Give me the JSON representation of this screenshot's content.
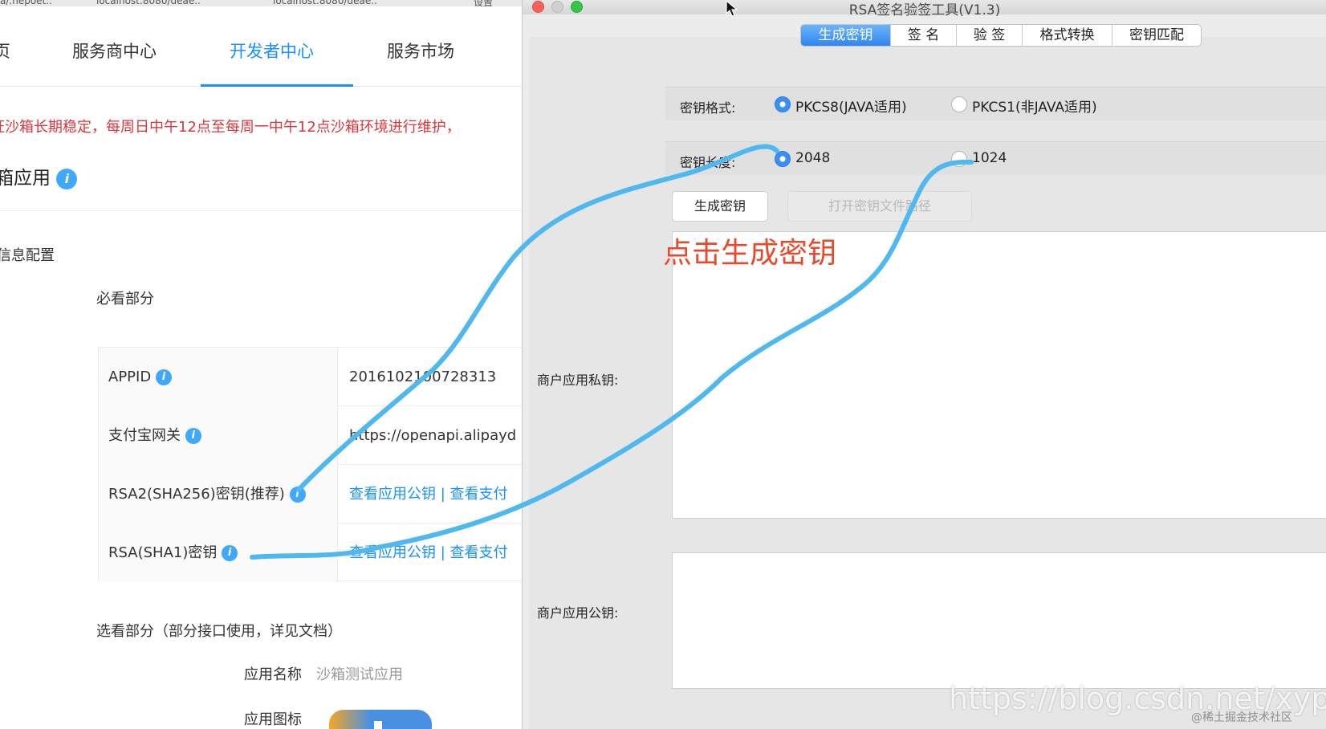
{
  "browser": {
    "tab_fragments": [
      "a/.hepoet..",
      "localhost:8080/deae..",
      "localhost:8080/deae..",
      "设置"
    ],
    "nav": {
      "items": [
        {
          "label": "页",
          "active": false
        },
        {
          "label": "服务商中心",
          "active": false
        },
        {
          "label": "开发者中心",
          "active": true
        },
        {
          "label": "服务市场",
          "active": false
        }
      ]
    },
    "notice": "证沙箱长期稳定，每周日中午12点至每周一中午12点沙箱环境进行维护，",
    "section_title": "箱应用",
    "sub_title": "信息配置",
    "must_title": "必看部分",
    "table": [
      {
        "label": "APPID",
        "value": "2016102100728313",
        "link": false
      },
      {
        "label": "支付宝网关",
        "value": "https://openapi.alipayd",
        "link": false
      },
      {
        "label": "RSA2(SHA256)密钥(推荐)",
        "value": "查看应用公钥 | 查看支付",
        "link": true
      },
      {
        "label": "RSA(SHA1)密钥",
        "value": "查看应用公钥 | 查看支付",
        "link": true
      }
    ],
    "optional_title": "选看部分（部分接口使用，详见文档）",
    "app_name_label": "应用名称",
    "app_name_value": "沙箱测试应用",
    "app_icon_label": "应用图标"
  },
  "tool": {
    "window_title": "RSA签名验签工具(V1.3)",
    "tabs": [
      {
        "label": "生成密钥",
        "active": true
      },
      {
        "label": "签 名",
        "active": false
      },
      {
        "label": "验 签",
        "active": false
      },
      {
        "label": "格式转换",
        "active": false
      },
      {
        "label": "密钥匹配",
        "active": false
      }
    ],
    "key_format_label": "密钥格式:",
    "key_format_options": [
      {
        "label": "PKCS8(JAVA适用)",
        "selected": true
      },
      {
        "label": "PKCS1(非JAVA适用)",
        "selected": false
      }
    ],
    "key_length_label": "密钥长度:",
    "key_length_options": [
      {
        "label": "2048",
        "selected": true
      },
      {
        "label": "1024",
        "selected": false
      }
    ],
    "generate_button": "生成密钥",
    "open_path_button": "打开密钥文件路径",
    "private_key_label": "商户应用私钥:",
    "private_key_value": "",
    "public_key_label": "商户应用公钥:",
    "public_key_value": ""
  },
  "annotation": "点击生成密钥",
  "watermark": "https://blog.csdn.net/xyphf",
  "watermark2": "@稀土掘金技术社区",
  "colors": {
    "accent": "#1890ff",
    "notice_red": "#d9363e",
    "annotation_red": "#e8492b",
    "scribble_blue": "#4fb8ee",
    "tab_active": "#2f86f0"
  }
}
